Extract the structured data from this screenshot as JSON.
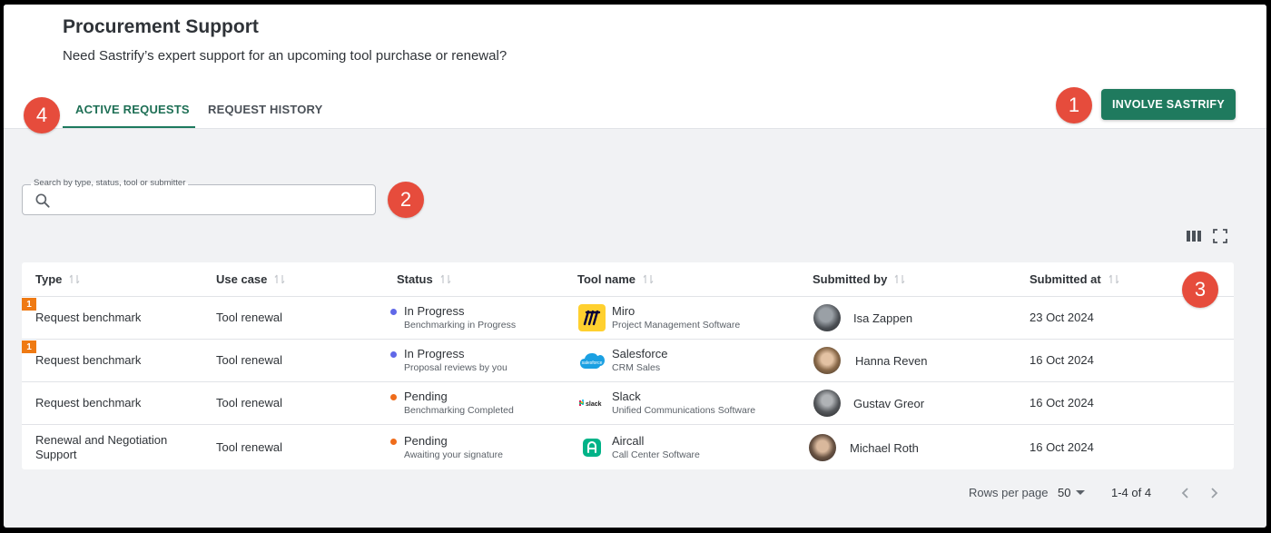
{
  "header": {
    "title": "Procurement Support",
    "subtitle": "Need Sastrify’s expert support for an upcoming tool purchase or renewal?"
  },
  "tabs": [
    {
      "label": "ACTIVE REQUESTS",
      "active": true
    },
    {
      "label": "REQUEST HISTORY",
      "active": false
    }
  ],
  "primary_button": {
    "label": "INVOLVE SASTRIFY"
  },
  "markers": [
    "1",
    "2",
    "3",
    "4"
  ],
  "search": {
    "label": "Search by type, status, tool or submitter",
    "value": "",
    "placeholder": ""
  },
  "table": {
    "columns": [
      "Type",
      "Use case",
      "Status",
      "Tool name",
      "Submitted by",
      "Submitted at"
    ],
    "rows": [
      {
        "badge": "1",
        "type": "Request benchmark",
        "use_case": "Tool renewal",
        "status": "In Progress",
        "status_detail": "Benchmarking in Progress",
        "status_color": "#6068e8",
        "tool": "Miro",
        "tool_category": "Project Management Software",
        "tool_icon": "miro-logo",
        "submitter": "Isa Zappen",
        "submitted_at": "23 Oct 2024"
      },
      {
        "badge": "1",
        "type": "Request benchmark",
        "use_case": "Tool renewal",
        "status": "In Progress",
        "status_detail": "Proposal reviews by you",
        "status_color": "#6068e8",
        "tool": "Salesforce",
        "tool_category": "CRM Sales",
        "tool_icon": "salesforce-logo",
        "submitter": "Hanna Reven",
        "submitted_at": "16 Oct 2024"
      },
      {
        "badge": "",
        "type": "Request benchmark",
        "use_case": "Tool renewal",
        "status": "Pending",
        "status_detail": "Benchmarking Completed",
        "status_color": "#ef6c1a",
        "tool": "Slack",
        "tool_category": "Unified Communications Software",
        "tool_icon": "slack-logo",
        "submitter": "Gustav Greor",
        "submitted_at": "16 Oct 2024"
      },
      {
        "badge": "",
        "type": "Renewal and Negotiation Support",
        "use_case": "Tool renewal",
        "status": "Pending",
        "status_detail": "Awaiting your signature",
        "status_color": "#ef6c1a",
        "tool": "Aircall",
        "tool_category": "Call Center Software",
        "tool_icon": "aircall-logo",
        "submitter": "Michael Roth",
        "submitted_at": "16 Oct 2024"
      }
    ]
  },
  "pagination": {
    "rows_per_page_label": "Rows per page",
    "rows_per_page_value": "50",
    "range": "1-4 of 4"
  },
  "colors": {
    "accent": "#1f7a5e",
    "marker": "#e64c3c",
    "badge": "#ef7a13"
  }
}
